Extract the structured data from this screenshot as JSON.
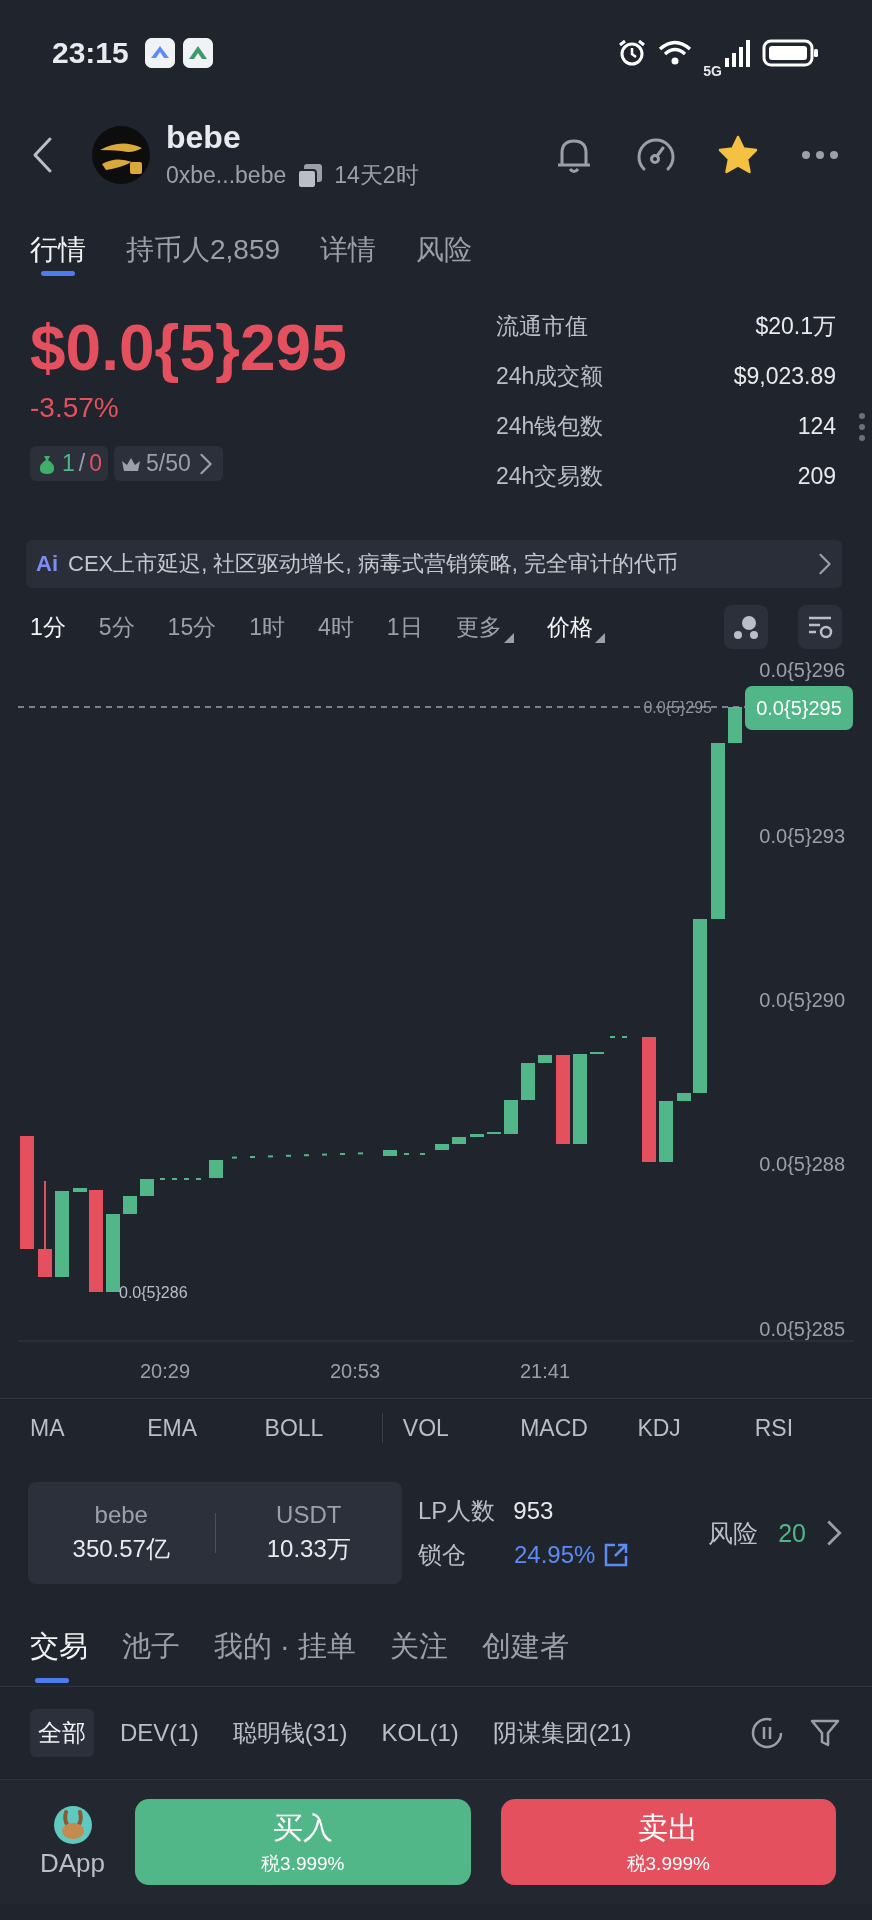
{
  "status_bar": {
    "time": "23:15",
    "network": "5G"
  },
  "header": {
    "token_name": "bebe",
    "address": "0xbe...bebe",
    "age": "14天2时",
    "favorite": true
  },
  "tabs": [
    {
      "label": "行情",
      "selected": true
    },
    {
      "label": "持币人2,859",
      "selected": false
    },
    {
      "label": "详情",
      "selected": false
    },
    {
      "label": "风险",
      "selected": false
    }
  ],
  "price": {
    "value": "$0.0{5}295",
    "change": "-3.57%"
  },
  "badges": [
    {
      "kind": "money",
      "parts": [
        {
          "text": "1",
          "color": "#52b788"
        },
        {
          "text": "/",
          "color": "#9aa0aa"
        },
        {
          "text": "0",
          "color": "#e5505f"
        }
      ]
    },
    {
      "kind": "top",
      "parts": [
        {
          "text": "5/50",
          "color": "#9aa0aa"
        }
      ]
    }
  ],
  "stats": [
    {
      "label": "流通市值",
      "value": "$20.1万"
    },
    {
      "label": "24h成交额",
      "value": "$9,023.89"
    },
    {
      "label": "24h钱包数",
      "value": "124"
    },
    {
      "label": "24h交易数",
      "value": "209"
    }
  ],
  "ai_summary": {
    "badge": "Ai",
    "text": "CEX上市延迟, 社区驱动增长, 病毒式营销策略, 完全审计的代币"
  },
  "intervals": [
    {
      "label": "1分",
      "selected": true,
      "kind": "option"
    },
    {
      "label": "5分",
      "selected": false,
      "kind": "option"
    },
    {
      "label": "15分",
      "selected": false,
      "kind": "option"
    },
    {
      "label": "1时",
      "selected": false,
      "kind": "option"
    },
    {
      "label": "4时",
      "selected": false,
      "kind": "option"
    },
    {
      "label": "1日",
      "selected": false,
      "kind": "option"
    },
    {
      "label": "更多",
      "selected": false,
      "kind": "dropdown"
    }
  ],
  "chart_type": {
    "label": "价格"
  },
  "chart": {
    "y_labels": [
      "0.0{5}296",
      "0.0{5}293",
      "0.0{5}290",
      "0.0{5}288",
      "0.0{5}285"
    ],
    "current_price": "0.0{5}295",
    "last_price_label": "0.0{5}295",
    "low_label": "0.0{5}286",
    "x_labels": [
      "20:29",
      "20:53",
      "21:41"
    ]
  },
  "main_indicators": [
    "MA",
    "EMA",
    "BOLL"
  ],
  "sub_indicators": [
    "VOL",
    "MACD",
    "KDJ",
    "RSI"
  ],
  "pool": {
    "token_symbol": "bebe",
    "token_amount": "350.57亿",
    "quote_symbol": "USDT",
    "quote_amount": "10.33万",
    "lp_label": "LP人数",
    "lp_count": "953",
    "lock_label": "锁仓",
    "lock_value": "24.95%",
    "risk_label": "风险",
    "risk_score": "20"
  },
  "trade_tabs": [
    {
      "label": "交易",
      "selected": true
    },
    {
      "label": "池子",
      "selected": false
    },
    {
      "label": "我的 · 挂单",
      "selected": false
    },
    {
      "label": "关注",
      "selected": false
    },
    {
      "label": "创建者",
      "selected": false
    }
  ],
  "filters": [
    {
      "label": "全部",
      "selected": true
    },
    {
      "label": "DEV(1)",
      "selected": false
    },
    {
      "label": "聪明钱(31)",
      "selected": false
    },
    {
      "label": "KOL(1)",
      "selected": false
    },
    {
      "label": "阴谋集团(21)",
      "selected": false
    }
  ],
  "bottom": {
    "dapp_label": "DApp",
    "buy": {
      "label": "买入",
      "tax": "税3.999%"
    },
    "sell": {
      "label": "卖出",
      "tax": "税3.999%"
    }
  }
}
